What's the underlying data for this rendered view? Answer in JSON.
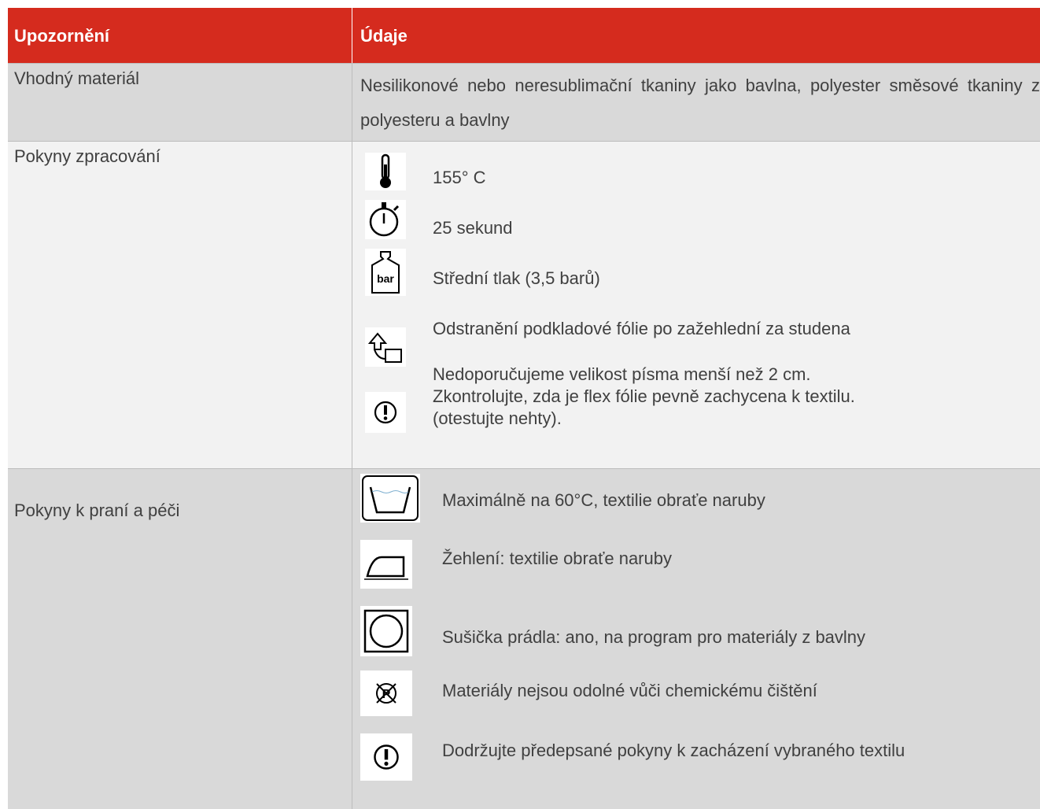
{
  "header": {
    "col1": "Upozornění",
    "col2": "Údaje"
  },
  "material": {
    "label": "Vhodný materiál",
    "text": "Nesilikonové nebo neresublimační tkaniny jako bavlna, polyester směsové tkaniny z polyesteru a bavlny"
  },
  "processing": {
    "label": "Pokyny zpracování",
    "items": [
      {
        "icon": "thermometer-icon",
        "text": "155° C"
      },
      {
        "icon": "stopwatch-icon",
        "text": "25 sekund"
      },
      {
        "icon": "weight-bar-icon",
        "icon_label": "bar",
        "text": "Střední tlak (3,5 barů)"
      },
      {
        "icon": "peel-arrow-icon",
        "text": "Odstranění podkladové fólie po zažehlední za studena"
      },
      {
        "icon": "warning-icon",
        "text": "Nedoporučujeme velikost písma menší než 2 cm.\nZkontrolujte, zda je flex fólie pevně zachycena k textilu.\n(otestujte nehty)."
      }
    ]
  },
  "care": {
    "label": "Pokyny k praní a péči",
    "items": [
      {
        "icon": "washing-tub-icon",
        "text": "Maximálně na 60°C, textilie obraťe naruby"
      },
      {
        "icon": "iron-icon",
        "text": "Žehlení: textilie obraťe naruby"
      },
      {
        "icon": "tumble-dryer-icon",
        "text": "Sušička prádla: ano, na program pro materiály z bavlny"
      },
      {
        "icon": "no-dry-clean-icon",
        "icon_label": "P",
        "text": "Materiály nejsou odolné vůči chemickému čištění"
      },
      {
        "icon": "warning-icon",
        "text": "Dodržujte předepsané pokyny k zacházení vybraného textilu"
      }
    ]
  },
  "colors": {
    "header_bg": "#d52b1e",
    "row_dark": "#d9d9d9",
    "row_light": "#f2f2f2",
    "text": "#404040"
  }
}
